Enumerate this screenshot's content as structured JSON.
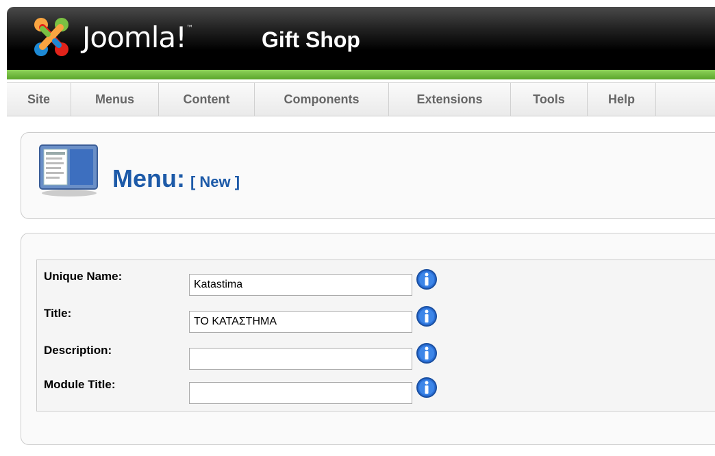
{
  "header": {
    "brand": "Joomla!",
    "trademark": "™",
    "site_name": "Gift Shop"
  },
  "menubar": {
    "items": [
      "Site",
      "Menus",
      "Content",
      "Components",
      "Extensions",
      "Tools",
      "Help"
    ]
  },
  "page": {
    "title": "Menu:",
    "subtitle": "[ New ]"
  },
  "form": {
    "fields": [
      {
        "label": "Unique Name:",
        "value": "Katastima"
      },
      {
        "label": "Title:",
        "value": "ΤΟ ΚΑΤΑΣΤΗΜΑ"
      },
      {
        "label": "Description:",
        "value": ""
      },
      {
        "label": "Module Title:",
        "value": ""
      }
    ]
  },
  "colors": {
    "title_blue": "#1d5aa8",
    "green_bar": "#6fbf3a",
    "info_blue": "#2a6fd6"
  },
  "icons": {
    "logo": "joomla-logo",
    "menu": "menu-manager-icon",
    "info": "info-icon"
  }
}
